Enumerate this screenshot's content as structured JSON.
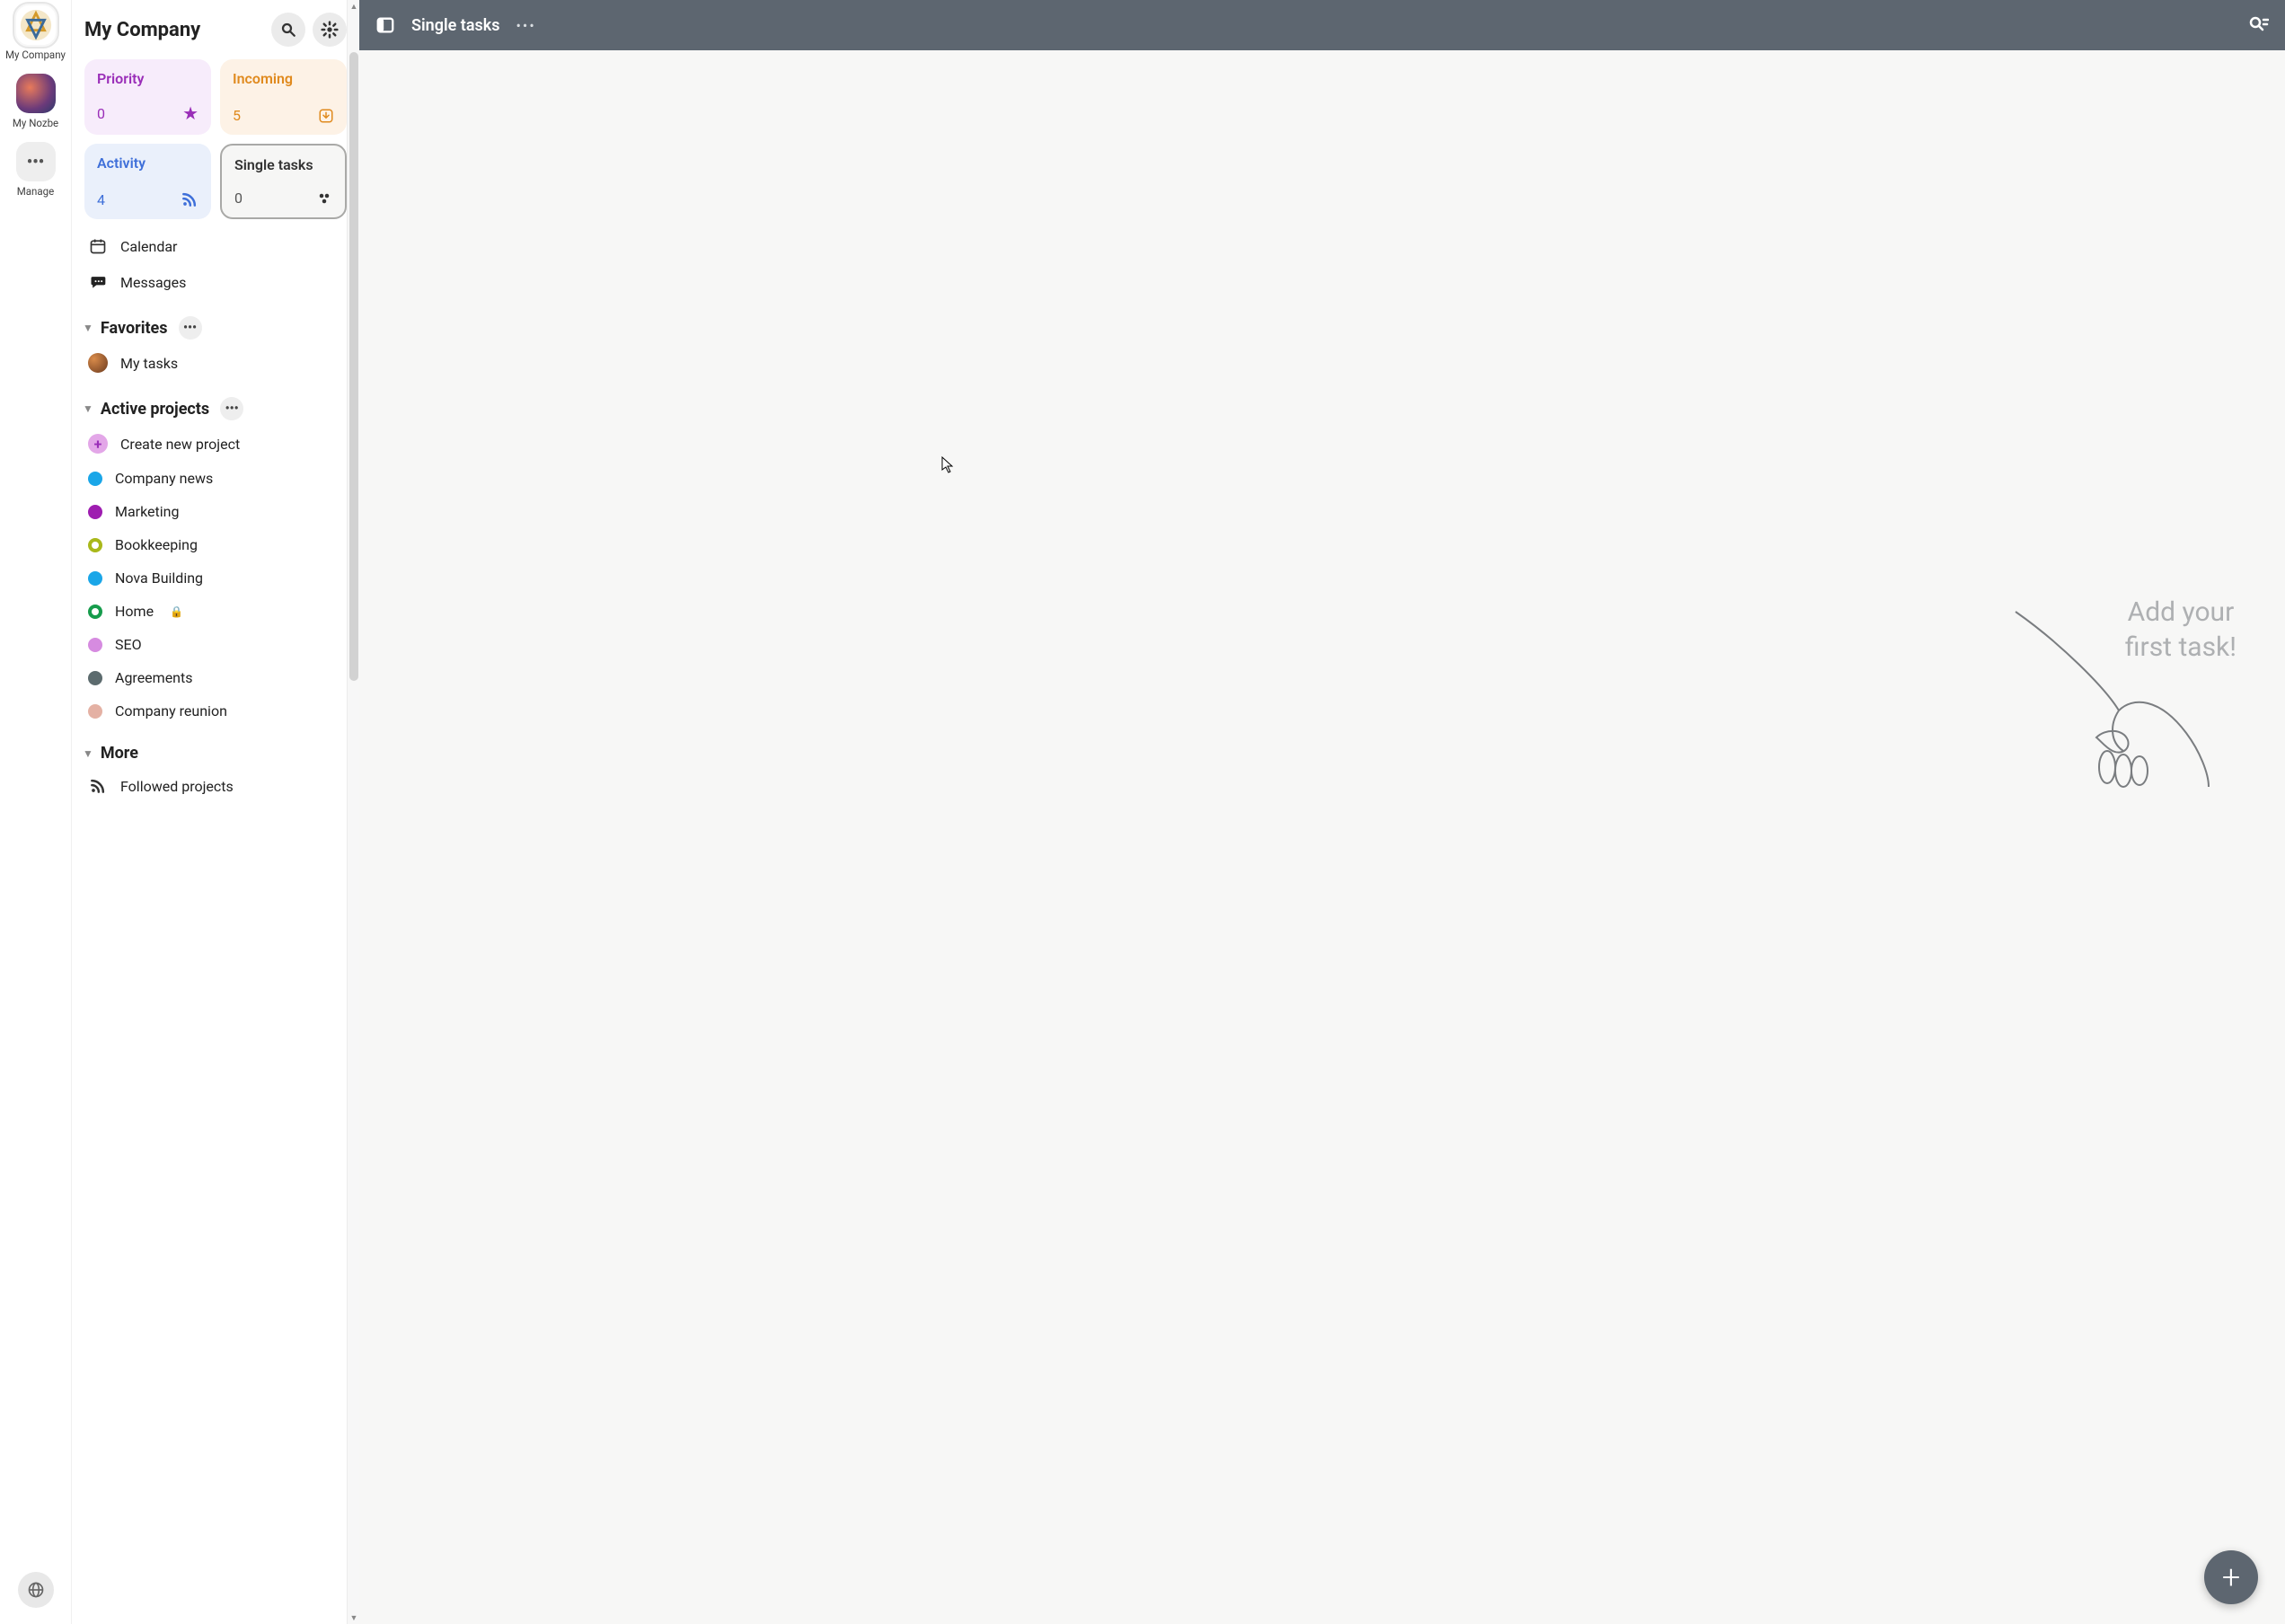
{
  "rail": {
    "workspaces": [
      {
        "label": "My Company",
        "active": true
      },
      {
        "label": "My Nozbe",
        "active": false
      },
      {
        "label": "Manage",
        "active": false
      }
    ]
  },
  "sidebar": {
    "title": "My Company",
    "cards": {
      "priority": {
        "title": "Priority",
        "count": "0"
      },
      "incoming": {
        "title": "Incoming",
        "count": "5"
      },
      "activity": {
        "title": "Activity",
        "count": "4"
      },
      "single": {
        "title": "Single tasks",
        "count": "0"
      }
    },
    "nav": {
      "calendar": "Calendar",
      "messages": "Messages"
    },
    "favorites": {
      "header": "Favorites",
      "items": [
        {
          "label": "My tasks"
        }
      ]
    },
    "active_projects": {
      "header": "Active projects",
      "create_label": "Create new project",
      "items": [
        {
          "label": "Company news",
          "color": "#1aa6e8",
          "shape": "dot"
        },
        {
          "label": "Marketing",
          "color": "#9e1db0",
          "shape": "dot"
        },
        {
          "label": "Bookkeeping",
          "color": "#a9b81a",
          "shape": "ring"
        },
        {
          "label": "Nova Building",
          "color": "#1aa6e8",
          "shape": "dot"
        },
        {
          "label": "Home",
          "color": "#169c4c",
          "shape": "ring",
          "locked": true
        },
        {
          "label": "SEO",
          "color": "#d68be0",
          "shape": "dot"
        },
        {
          "label": "Agreements",
          "color": "#5c6b6e",
          "shape": "dot"
        },
        {
          "label": "Company reunion",
          "color": "#e4b1a4",
          "shape": "dot"
        }
      ]
    },
    "more": {
      "header": "More",
      "followed": "Followed projects"
    }
  },
  "topbar": {
    "title": "Single tasks"
  },
  "empty": {
    "line1": "Add your",
    "line2": "first task!"
  }
}
